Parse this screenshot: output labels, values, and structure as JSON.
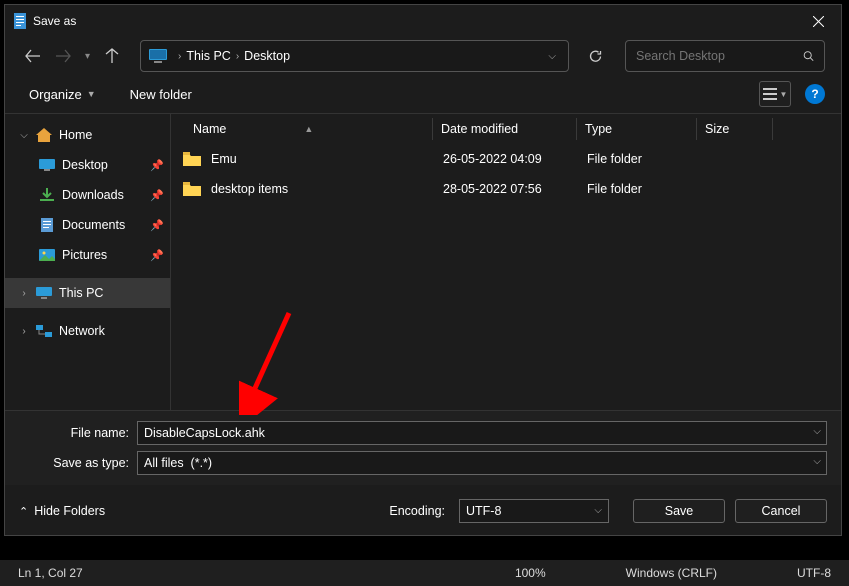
{
  "window": {
    "title": "Save as"
  },
  "breadcrumb": {
    "root": "This PC",
    "folder": "Desktop"
  },
  "search": {
    "placeholder": "Search Desktop"
  },
  "toolbar": {
    "organize": "Organize",
    "newfolder": "New folder"
  },
  "sidebar": {
    "home": "Home",
    "desktop": "Desktop",
    "downloads": "Downloads",
    "documents": "Documents",
    "pictures": "Pictures",
    "thispc": "This PC",
    "network": "Network"
  },
  "columns": {
    "name": "Name",
    "date": "Date modified",
    "type": "Type",
    "size": "Size"
  },
  "files": [
    {
      "name": "Emu",
      "date": "26-05-2022 04:09",
      "type": "File folder"
    },
    {
      "name": "desktop items",
      "date": "28-05-2022 07:56",
      "type": "File folder"
    }
  ],
  "labels": {
    "filename": "File name:",
    "saveastype": "Save as type:",
    "encoding": "Encoding:",
    "hidefolders": "Hide Folders",
    "save": "Save",
    "cancel": "Cancel"
  },
  "values": {
    "filename": "DisableCapsLock.ahk",
    "saveastype": "All files  (*.*)",
    "encoding": "UTF-8"
  },
  "status": {
    "pos": "Ln 1, Col 27",
    "zoom": "100%",
    "eol": "Windows (CRLF)",
    "enc": "UTF-8"
  },
  "help": "?"
}
